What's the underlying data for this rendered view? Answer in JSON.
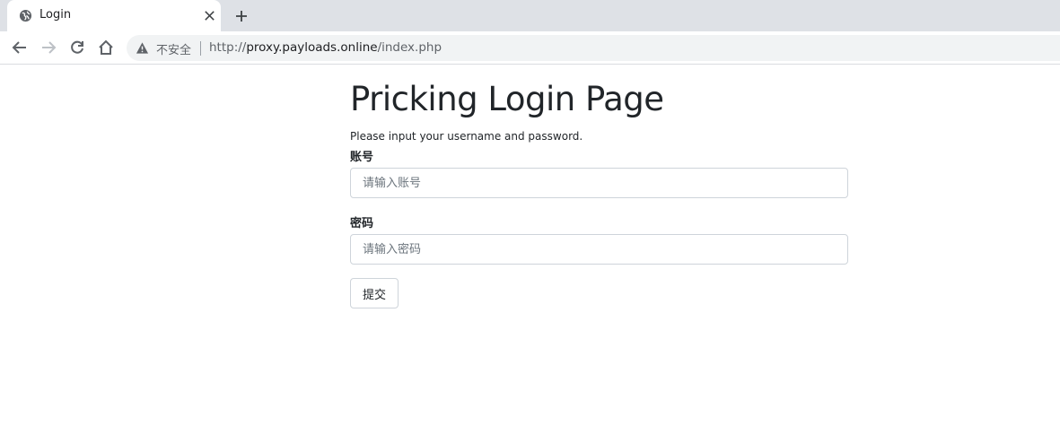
{
  "tab": {
    "title": "Login",
    "favicon": "globe-icon",
    "close_icon": "close-icon",
    "new_tab_icon": "plus-icon"
  },
  "toolbar": {
    "back_icon": "back-arrow-icon",
    "forward_icon": "forward-arrow-icon",
    "reload_icon": "reload-icon",
    "home_icon": "home-icon",
    "security_icon": "warning-icon",
    "security_text": "不安全",
    "url_scheme": "http://",
    "url_host": "proxy.payloads.online",
    "url_path": "/index.php"
  },
  "page": {
    "heading": "Pricking Login Page",
    "subtitle": "Please input your username and password.",
    "username_label": "账号",
    "username_placeholder": "请输入账号",
    "password_label": "密码",
    "password_placeholder": "请输入密码",
    "submit_label": "提交"
  },
  "colors": {
    "tabstrip_bg": "#dee1e6",
    "omnibox_bg": "#f1f3f4",
    "text": "#212529",
    "border": "#ced4da"
  }
}
